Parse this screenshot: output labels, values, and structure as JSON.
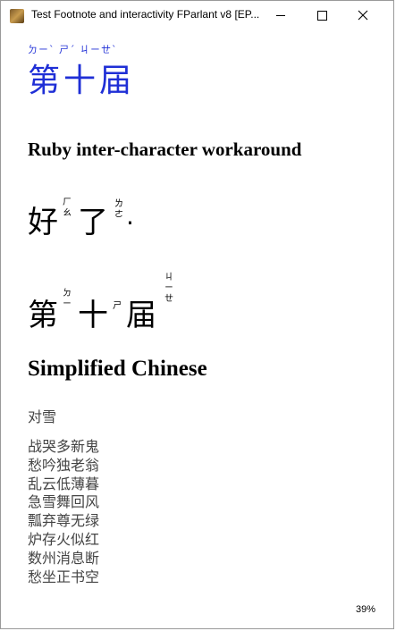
{
  "window": {
    "title": "Test Footnote and interactivity FParlant v8 [EP...",
    "icon": "app-book-icon"
  },
  "content": {
    "ruby_title": {
      "reading": "ㄉㄧˋ ㄕˊ ㄐㄧㄝˋ",
      "base": "第十届",
      "color": "#1f2fd6"
    },
    "heading_workaround": "Ruby inter-character workaround",
    "line1": {
      "chars": [
        "好",
        "了"
      ],
      "readings": [
        [
          "ㄏ",
          "ㄠ"
        ],
        [
          "ㄌ",
          "ㄜ"
        ]
      ],
      "tail": "."
    },
    "line2": {
      "chars": [
        "第",
        "十",
        "届"
      ],
      "readings": [
        [
          "ㄉ",
          "ㄧ"
        ],
        [
          "ㄕ"
        ],
        [
          "ㄐ",
          "ㄧ",
          "ㄝ"
        ]
      ]
    },
    "heading_simplified": "Simplified Chinese",
    "poem_title": "对雪",
    "poem_lines": [
      "战哭多新鬼",
      "愁吟独老翁",
      "乱云低薄暮",
      "急雪舞回风",
      "瓢弃尊无绿",
      "炉存火似红",
      "数州消息断",
      "愁坐正书空"
    ]
  },
  "status": {
    "progress_percent": "39%"
  }
}
